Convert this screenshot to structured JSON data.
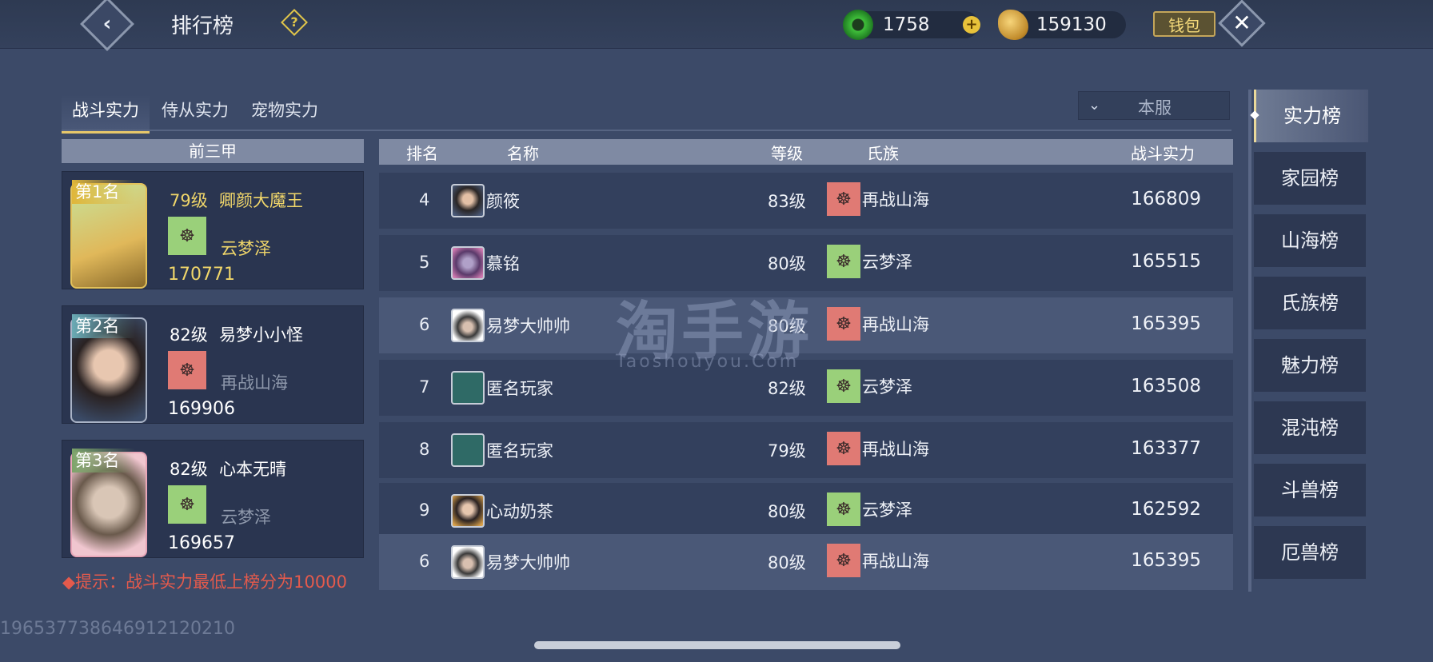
{
  "header": {
    "back_icon": "chevron-left-icon",
    "title": "排行榜",
    "help_icon": "question-icon",
    "jade_value": "1758",
    "gold_value": "159130",
    "wallet_label": "钱包",
    "close_icon": "close-icon"
  },
  "tabs": [
    "战斗实力",
    "侍从实力",
    "宠物实力"
  ],
  "server_select": {
    "value": "本服"
  },
  "top3": {
    "header": "前三甲",
    "cards": [
      {
        "rank": "第1名",
        "level": "79级",
        "name": "卿颜大魔王",
        "clan": "云梦泽",
        "power": "170771",
        "color": "#f0d66a",
        "clan_color": "#f0d66a"
      },
      {
        "rank": "第2名",
        "level": "82级",
        "name": "易梦小小怪",
        "clan": "再战山海",
        "power": "169906",
        "color": "#ffffff",
        "clan_color": "#8e98ab"
      },
      {
        "rank": "第3名",
        "level": "82级",
        "name": "心本无晴",
        "clan": "云梦泽",
        "power": "169657",
        "color": "#ffffff",
        "clan_color": "#8e98ab"
      }
    ]
  },
  "hint": "◆提示：战斗实力最低上榜分为10000",
  "table": {
    "headers": {
      "rank": "排名",
      "name": "名称",
      "level": "等级",
      "clan": "氏族",
      "power": "战斗实力"
    },
    "rows": [
      {
        "rank": "4",
        "name": "颜筱",
        "level": "83级",
        "clan": "再战山海",
        "power": "166809"
      },
      {
        "rank": "5",
        "name": "慕铭",
        "level": "80级",
        "clan": "云梦泽",
        "power": "165515"
      },
      {
        "rank": "6",
        "name": "易梦大帅帅",
        "level": "80级",
        "clan": "再战山海",
        "power": "165395"
      },
      {
        "rank": "7",
        "name": "匿名玩家",
        "level": "82级",
        "clan": "云梦泽",
        "power": "163508"
      },
      {
        "rank": "8",
        "name": "匿名玩家",
        "level": "79级",
        "clan": "再战山海",
        "power": "163377"
      },
      {
        "rank": "9",
        "name": "心动奶茶",
        "level": "80级",
        "clan": "云梦泽",
        "power": "162592"
      }
    ],
    "self_row": {
      "rank": "6",
      "name": "易梦大帅帅",
      "level": "80级",
      "clan": "再战山海",
      "power": "165395"
    }
  },
  "sidebar": [
    "实力榜",
    "家园榜",
    "山海榜",
    "氏族榜",
    "魅力榜",
    "混沌榜",
    "斗兽榜",
    "厄兽榜"
  ],
  "watermark": {
    "main": "淘手游",
    "sub": "Taoshouyou.Com"
  },
  "footer_id": "196537738646912120210",
  "colors": {
    "clan_red": "#e07a74",
    "clan_green": "#9ad07a",
    "gold_text": "#f0d66a",
    "hint_red": "#e45a4c"
  }
}
